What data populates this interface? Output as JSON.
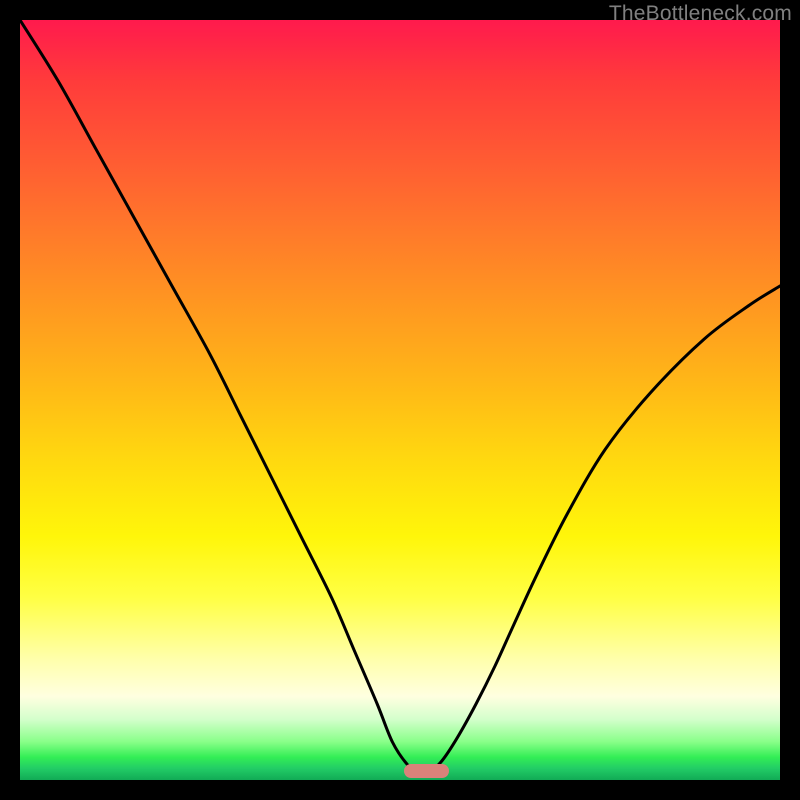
{
  "watermark": "TheBottleneck.com",
  "chart_data": {
    "type": "line",
    "title": "",
    "xlabel": "",
    "ylabel": "",
    "xlim": [
      0,
      1
    ],
    "ylim": [
      0,
      1
    ],
    "background_gradient": {
      "top": "#ff1a4d",
      "upper_mid": "#ff9920",
      "mid": "#fff60a",
      "lower_mid": "#ffffaa",
      "bottom": "#11aa55"
    },
    "series": [
      {
        "name": "bottleneck-curve",
        "x": [
          0.0,
          0.05,
          0.1,
          0.15,
          0.2,
          0.25,
          0.29,
          0.33,
          0.37,
          0.41,
          0.44,
          0.47,
          0.49,
          0.51,
          0.525,
          0.54,
          0.555,
          0.575,
          0.6,
          0.625,
          0.65,
          0.68,
          0.72,
          0.77,
          0.83,
          0.9,
          0.96,
          1.0
        ],
        "values": [
          1.0,
          0.92,
          0.83,
          0.74,
          0.65,
          0.56,
          0.48,
          0.4,
          0.32,
          0.24,
          0.17,
          0.1,
          0.05,
          0.02,
          0.01,
          0.012,
          0.025,
          0.055,
          0.1,
          0.15,
          0.205,
          0.27,
          0.35,
          0.435,
          0.51,
          0.58,
          0.625,
          0.65
        ]
      }
    ],
    "marker": {
      "name": "optimal-zone",
      "x_start": 0.505,
      "x_end": 0.565,
      "y": 0.012,
      "color": "#d9827a"
    }
  },
  "colors": {
    "frame": "#000000",
    "curve": "#000000",
    "marker": "#d9827a",
    "watermark": "#808080"
  }
}
